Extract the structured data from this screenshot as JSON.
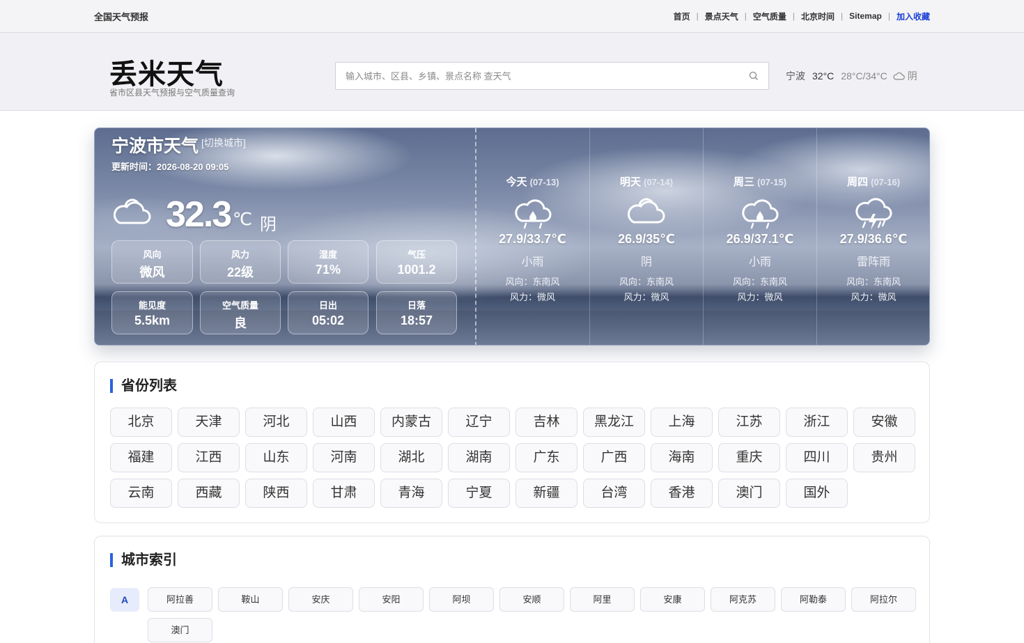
{
  "topbar": {
    "site_label": "全国天气预报",
    "nav": [
      "首页",
      "景点天气",
      "空气质量",
      "北京时间",
      "Sitemap"
    ],
    "favorite": "加入收藏"
  },
  "header": {
    "logo": "丢米天气",
    "slogan": "省市区县天气预报与空气质量查询",
    "search_placeholder": "输入城市、区县、乡镇、景点名称 查天气",
    "weather": {
      "city": "宁波",
      "temp": "32°C",
      "range": "28°C/34°C",
      "condition": "阴"
    }
  },
  "current": {
    "city_title": "宁波市天气",
    "switch_label": "[切换城市]",
    "update_time": "更新时间：2026-08-20 09:05",
    "temp": "32.3",
    "unit": "℃",
    "condition": "阴",
    "tiles": [
      {
        "label": "风向",
        "value": "微风"
      },
      {
        "label": "风力",
        "value": "22级"
      },
      {
        "label": "湿度",
        "value": "71%"
      },
      {
        "label": "气压",
        "value": "1001.2"
      },
      {
        "label": "能见度",
        "value": "5.5km"
      },
      {
        "label": "空气质量",
        "value": "良"
      },
      {
        "label": "日出",
        "value": "05:02"
      },
      {
        "label": "日落",
        "value": "18:57"
      }
    ]
  },
  "forecast": [
    {
      "day": "今天",
      "date": "(07-13)",
      "icon": "rain-cloud-icon",
      "temp": "27.9/33.7℃",
      "condition": "小雨",
      "wind_dir": "风向：东南风",
      "wind_force": "风力：微风"
    },
    {
      "day": "明天",
      "date": "(07-14)",
      "icon": "cloud-icon",
      "temp": "26.9/35℃",
      "condition": "阴",
      "wind_dir": "风向：东南风",
      "wind_force": "风力：微风"
    },
    {
      "day": "周三",
      "date": "(07-15)",
      "icon": "rain-cloud-icon",
      "temp": "26.9/37.1℃",
      "condition": "小雨",
      "wind_dir": "风向：东南风",
      "wind_force": "风力：微风"
    },
    {
      "day": "周四",
      "date": "(07-16)",
      "icon": "thunderstorm-icon",
      "temp": "27.9/36.6℃",
      "condition": "雷阵雨",
      "wind_dir": "风向：东南风",
      "wind_force": "风力：微风"
    }
  ],
  "provinces": {
    "title": "省份列表",
    "items": [
      "北京",
      "天津",
      "河北",
      "山西",
      "内蒙古",
      "辽宁",
      "吉林",
      "黑龙江",
      "上海",
      "江苏",
      "浙江",
      "安徽",
      "福建",
      "江西",
      "山东",
      "河南",
      "湖北",
      "湖南",
      "广东",
      "广西",
      "海南",
      "重庆",
      "四川",
      "贵州",
      "云南",
      "西藏",
      "陕西",
      "甘肃",
      "青海",
      "宁夏",
      "新疆",
      "台湾",
      "香港",
      "澳门",
      "国外"
    ]
  },
  "city_index": {
    "title": "城市索引",
    "letter": "A",
    "cities": [
      "阿拉善",
      "鞍山",
      "安庆",
      "安阳",
      "阿坝",
      "安顺",
      "阿里",
      "安康",
      "阿克苏",
      "阿勒泰",
      "阿拉尔",
      "澳门"
    ]
  },
  "colors": {
    "accent": "#2a62e0",
    "favorite_link": "#1a3fd6"
  }
}
